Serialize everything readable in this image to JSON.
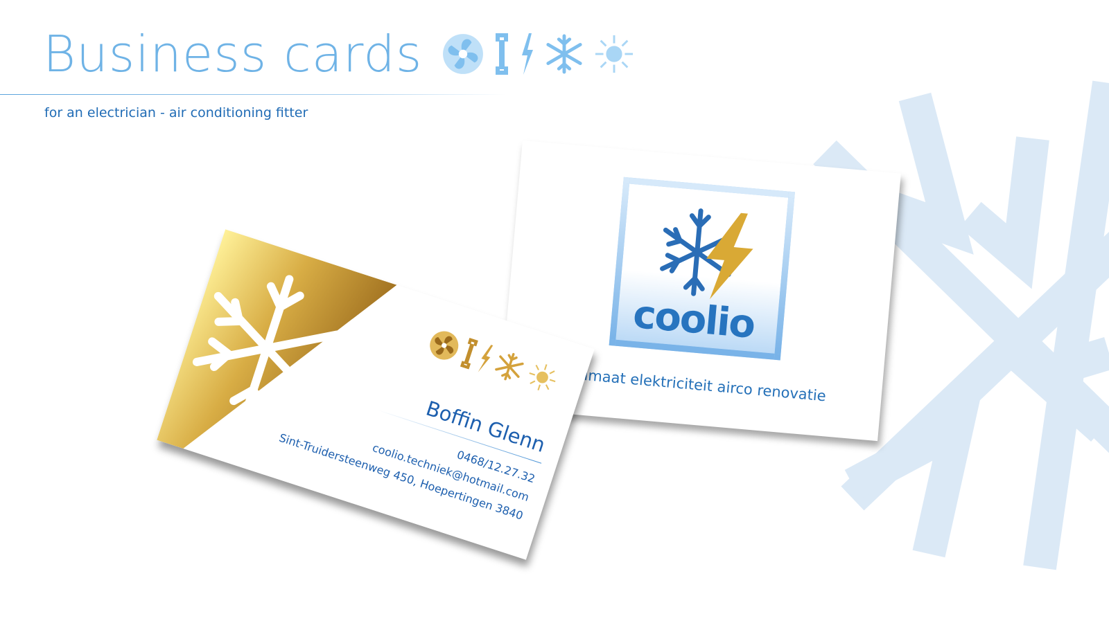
{
  "header": {
    "title": "Business cards",
    "subtitle": "for an electrician - air conditioning fitter",
    "icons": [
      "fan-icon",
      "wrench-icon",
      "lightning-icon",
      "snowflake-icon",
      "sun-icon"
    ]
  },
  "back_card": {
    "logo_text": "coolio",
    "tagline": "n klimaat elektriciteit airco renovatie"
  },
  "front_card": {
    "name": "Boffin Glenn",
    "phone": "0468/12.27.32",
    "email": "coolio.techniek@hotmail.com",
    "address": "Sint-Truidersteenweg 450, Hoepertingen 3840",
    "icons": [
      "fan-icon",
      "wrench-icon",
      "lightning-icon",
      "snowflake-icon",
      "sun-icon"
    ]
  },
  "colors": {
    "title_blue": "#6fb3e6",
    "text_blue": "#1d5fae",
    "gold_light": "#fde98f",
    "gold_dark": "#a8741a",
    "background_snowflake": "#dceaf6"
  }
}
